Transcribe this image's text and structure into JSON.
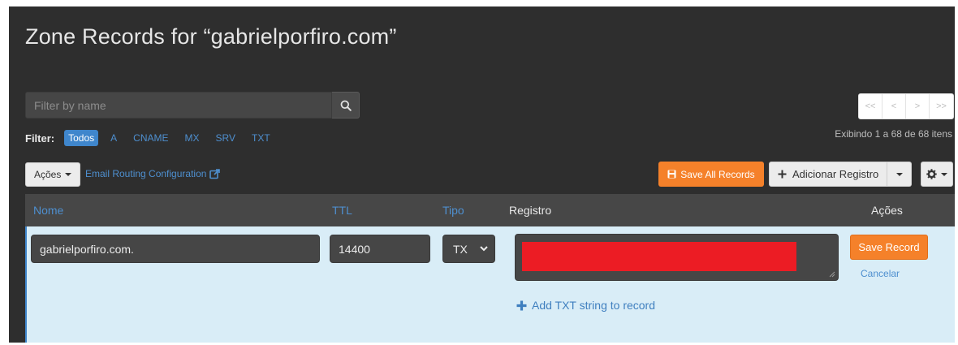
{
  "page": {
    "title": "Zone Records for “gabrielporfiro.com”"
  },
  "search": {
    "placeholder": "Filter by name",
    "value": ""
  },
  "filter": {
    "label": "Filter:",
    "options": [
      {
        "label": "Todos",
        "active": true
      },
      {
        "label": "A",
        "active": false
      },
      {
        "label": "CNAME",
        "active": false
      },
      {
        "label": "MX",
        "active": false
      },
      {
        "label": "SRV",
        "active": false
      },
      {
        "label": "TXT",
        "active": false
      }
    ]
  },
  "pagination": {
    "first": "<<",
    "prev": "<",
    "next": ">",
    "last": ">>",
    "info": "Exibindo 1 a 68 de 68 itens"
  },
  "toolbar": {
    "acoes_label": "Ações",
    "email_routing_label": "Email Routing Configuration",
    "save_all_label": "Save All Records",
    "add_record_label": "Adicionar Registro"
  },
  "table": {
    "headers": {
      "nome": "Nome",
      "ttl": "TTL",
      "tipo": "Tipo",
      "registro": "Registro",
      "acoes": "Ações"
    },
    "edit_row": {
      "nome": "gabrielporfiro.com.",
      "ttl": "14400",
      "tipo": "TX",
      "add_txt_label": "Add TXT string to record",
      "save_label": "Save Record",
      "cancel_label": "Cancelar"
    }
  },
  "colors": {
    "accent_blue": "#3f86cc",
    "orange": "#f5812a",
    "redaction": "#ec1c24",
    "row_highlight": "#d9edf7"
  }
}
